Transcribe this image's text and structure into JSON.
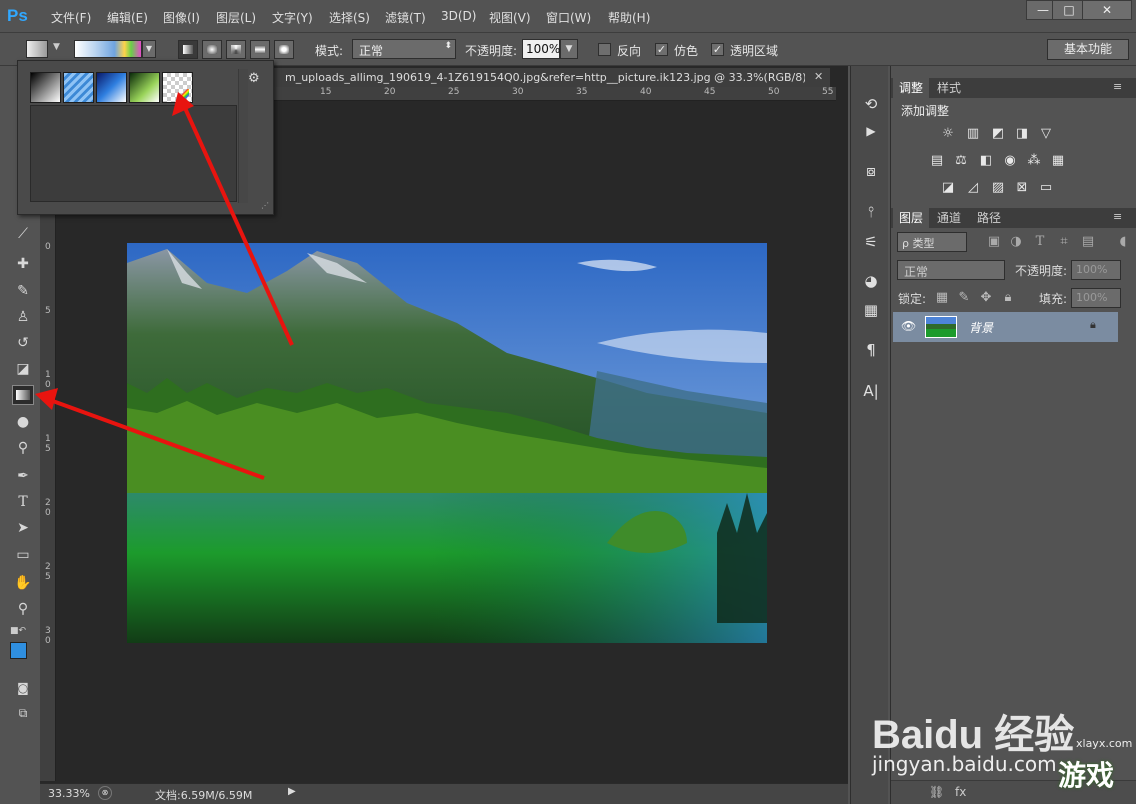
{
  "app": {
    "logo": "Ps"
  },
  "menu": [
    "文件(F)",
    "编辑(E)",
    "图像(I)",
    "图层(L)",
    "文字(Y)",
    "选择(S)",
    "滤镜(T)",
    "3D(D)",
    "视图(V)",
    "窗口(W)",
    "帮助(H)"
  ],
  "window_controls": {
    "minimize": "—",
    "restore": "□",
    "close": "✕"
  },
  "options": {
    "mode_label": "模式:",
    "mode_value": "正常",
    "opacity_label": "不透明度:",
    "opacity_value": "100%",
    "reverse_label": "反向",
    "dither_label": "仿色",
    "transparency_label": "透明区域",
    "dither_checked": "✓",
    "transparency_checked": "✓",
    "workspace": "基本功能"
  },
  "document": {
    "tab_title": "m_uploads_allimg_190619_4-1Z619154Q0.jpg&refer=http__picture.ik123.jpg @ 33.3%(RGB/8)",
    "zoom": "33.33%",
    "doc_size": "文档:6.59M/6.59M",
    "ruler_top": [
      "15",
      "20",
      "25",
      "30",
      "35",
      "40",
      "45",
      "50",
      "55"
    ],
    "ruler_left": [
      "0",
      "5",
      "1",
      "0",
      "1",
      "5",
      "2",
      "0",
      "2",
      "5",
      "3",
      "0"
    ]
  },
  "gradient_presets": {
    "swatches": [
      "black-white",
      "blue-stripes",
      "blue-dark",
      "green-dark",
      "transparent-rainbow"
    ],
    "gear": "⚙"
  },
  "panels": {
    "adjust_tabs": [
      "调整",
      "样式"
    ],
    "adjust_title": "添加调整",
    "layers_tabs": [
      "图层",
      "通道",
      "路径"
    ],
    "filter_kind": "ρ 类型",
    "blend_mode": "正常",
    "opacity_label": "不透明度:",
    "opacity_value": "100%",
    "lock_label": "锁定:",
    "fill_label": "填充:",
    "fill_value": "100%",
    "layer_name": "背景"
  },
  "watermark": {
    "brand": "Baidu 经验",
    "site": "jingyan.baidu.com",
    "site2": "xlayx.com",
    "game_text": "游戏"
  },
  "colors": {
    "foreground": "#2f8fe0",
    "background": "#ffffff",
    "accent_arrow": "#e8140f"
  }
}
